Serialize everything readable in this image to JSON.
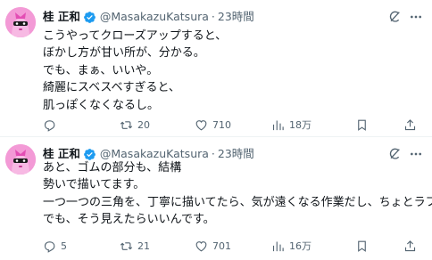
{
  "tweets": [
    {
      "author": {
        "display_name": "桂 正和",
        "handle": "@MasakazuKatsura",
        "avatar_icon": "avatar-pink-mask-character",
        "verified": true
      },
      "separator": "·",
      "time": "23時間",
      "body_lines": [
        "こうやってクローズアップすると、",
        "ぼかし方が甘い所が、分かる。",
        "でも、まぁ、いいや。",
        "綺麗にスベスベすぎると、",
        "肌っぽくなくなるし。"
      ],
      "stats": {
        "replies": "",
        "retweets": "20",
        "likes": "710",
        "views": "18万"
      }
    },
    {
      "author": {
        "display_name": "桂 正和",
        "handle": "@MasakazuKatsura",
        "avatar_icon": "avatar-pink-mask-character",
        "verified": true
      },
      "separator": "·",
      "time": "23時間",
      "body_lines": [
        "あと、ゴムの部分も、結構",
        "勢いで描いてます。",
        "一つ一つの三角を、丁寧に描いてたら、気が遠くなる作業だし、ちょとラフ",
        "でも、そう見えたらいいんです。"
      ],
      "stats": {
        "replies": "5",
        "retweets": "21",
        "likes": "701",
        "views": "16万"
      }
    }
  ],
  "colors": {
    "text": "#0f1419",
    "secondary": "#536471",
    "verified_badge": "#1d9bf0",
    "avatar_bg": "#f39ad6",
    "divider": "#eff3f4"
  },
  "icons": [
    "grok-icon",
    "more-icon",
    "reply-icon",
    "retweet-icon",
    "like-icon",
    "views-icon",
    "bookmark-icon",
    "share-icon"
  ]
}
